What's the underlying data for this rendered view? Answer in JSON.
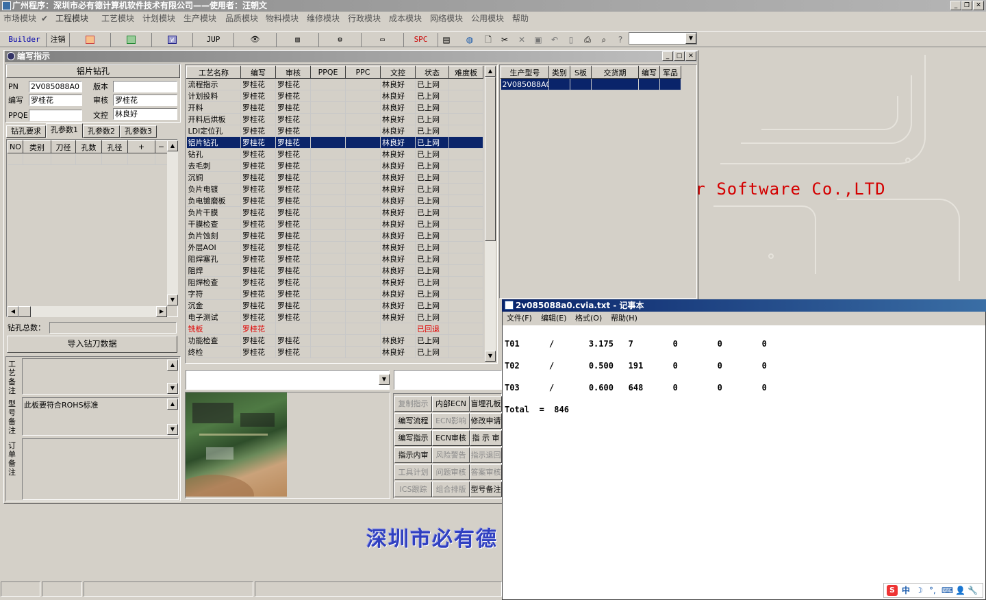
{
  "app": {
    "title": "广州程序：深圳市必有德计算机软件技术有限公司——使用者：汪朝文",
    "menu": [
      "市场模块",
      "工程模块",
      "工艺模块",
      "计划模块",
      "生产模块",
      "品质模块",
      "物料模块",
      "维修模块",
      "行政模块",
      "成本模块",
      "网络模块",
      "公用模块",
      "帮助"
    ]
  },
  "toolbar": {
    "builder": "Builder",
    "logout": "注销",
    "jup": "JUP",
    "spc": "SPC"
  },
  "background": {
    "brand_text": "er Software Co.,LTD",
    "company_text": "深圳市必有德"
  },
  "child_window": {
    "title": "编写指示",
    "section_title": "铝片钻孔",
    "pn_label": "PN",
    "pn_value": "2V085088A0",
    "version_label": "版本",
    "version_value": "",
    "author_label": "编写",
    "author_value": "罗桂花",
    "review_label": "审核",
    "review_value": "罗桂花",
    "ppqe_label": "PPQE",
    "ppqe_value": "",
    "doc_label": "文控",
    "doc_value": "林良好",
    "tabs": [
      "钻孔要求",
      "孔参数1",
      "孔参数2",
      "孔参数3"
    ],
    "hole_columns": [
      "NO",
      "类别",
      "刀径",
      "孔数",
      "孔径",
      "+",
      "−"
    ],
    "total_label": "钻孔总数：",
    "total_value": "",
    "import_button": "导入钻刀数据",
    "remark_labels": [
      "工艺备注",
      "型号备注",
      "订单备注"
    ],
    "model_remark": "此板要符合ROHS标准"
  },
  "process_table": {
    "columns": [
      "工艺名称",
      "编写",
      "审核",
      "PPQE",
      "PPC",
      "文控",
      "状态",
      "难度板"
    ],
    "rows": [
      [
        "流程指示",
        "罗桂花",
        "罗桂花",
        "",
        "",
        "林良好",
        "已上网",
        ""
      ],
      [
        "计划投料",
        "罗桂花",
        "罗桂花",
        "",
        "",
        "林良好",
        "已上网",
        ""
      ],
      [
        "开料",
        "罗桂花",
        "罗桂花",
        "",
        "",
        "林良好",
        "已上网",
        ""
      ],
      [
        "开料后烘板",
        "罗桂花",
        "罗桂花",
        "",
        "",
        "林良好",
        "已上网",
        ""
      ],
      [
        "LDI定位孔",
        "罗桂花",
        "罗桂花",
        "",
        "",
        "林良好",
        "已上网",
        ""
      ],
      [
        "铝片钻孔",
        "罗桂花",
        "罗桂花",
        "",
        "",
        "林良好",
        "已上网",
        ""
      ],
      [
        "钻孔",
        "罗桂花",
        "罗桂花",
        "",
        "",
        "林良好",
        "已上网",
        ""
      ],
      [
        "去毛刺",
        "罗桂花",
        "罗桂花",
        "",
        "",
        "林良好",
        "已上网",
        ""
      ],
      [
        "沉铜",
        "罗桂花",
        "罗桂花",
        "",
        "",
        "林良好",
        "已上网",
        ""
      ],
      [
        "负片电镀",
        "罗桂花",
        "罗桂花",
        "",
        "",
        "林良好",
        "已上网",
        ""
      ],
      [
        "负电镀磨板",
        "罗桂花",
        "罗桂花",
        "",
        "",
        "林良好",
        "已上网",
        ""
      ],
      [
        "负片干膜",
        "罗桂花",
        "罗桂花",
        "",
        "",
        "林良好",
        "已上网",
        ""
      ],
      [
        "干膜检查",
        "罗桂花",
        "罗桂花",
        "",
        "",
        "林良好",
        "已上网",
        ""
      ],
      [
        "负片蚀刻",
        "罗桂花",
        "罗桂花",
        "",
        "",
        "林良好",
        "已上网",
        ""
      ],
      [
        "外层AOI",
        "罗桂花",
        "罗桂花",
        "",
        "",
        "林良好",
        "已上网",
        ""
      ],
      [
        "阻焊塞孔",
        "罗桂花",
        "罗桂花",
        "",
        "",
        "林良好",
        "已上网",
        ""
      ],
      [
        "阻焊",
        "罗桂花",
        "罗桂花",
        "",
        "",
        "林良好",
        "已上网",
        ""
      ],
      [
        "阻焊检查",
        "罗桂花",
        "罗桂花",
        "",
        "",
        "林良好",
        "已上网",
        ""
      ],
      [
        "字符",
        "罗桂花",
        "罗桂花",
        "",
        "",
        "林良好",
        "已上网",
        ""
      ],
      [
        "沉金",
        "罗桂花",
        "罗桂花",
        "",
        "",
        "林良好",
        "已上网",
        ""
      ],
      [
        "电子测试",
        "罗桂花",
        "罗桂花",
        "",
        "",
        "林良好",
        "已上网",
        ""
      ],
      [
        "铣板",
        "罗桂花",
        "",
        "",
        "",
        "",
        "已回退",
        ""
      ],
      [
        "功能检查",
        "罗桂花",
        "罗桂花",
        "",
        "",
        "林良好",
        "已上网",
        ""
      ],
      [
        "终检",
        "罗桂花",
        "罗桂花",
        "",
        "",
        "林良好",
        "已上网",
        ""
      ]
    ],
    "selected_row": 5,
    "rejected_row": 21
  },
  "model_table": {
    "columns": [
      "生产型号",
      "类别",
      "S板",
      "交货期",
      "编写",
      "军品"
    ],
    "rows": [
      [
        "2V085088A0",
        "",
        "",
        "",
        "",
        ""
      ]
    ]
  },
  "action_buttons": [
    [
      "复制指示",
      "内部ECN",
      "盲埋孔板"
    ],
    [
      "编写流程",
      "ECN影响",
      "修改申请"
    ],
    [
      "编写指示",
      "ECN审核",
      "指 示 审"
    ],
    [
      "指示内审",
      "风险警告",
      "指示退回"
    ],
    [
      "工具计划",
      "问题审核",
      "答案审核"
    ],
    [
      "ICS跟踪",
      "组合排版",
      "型号备注"
    ]
  ],
  "disabled_buttons": [
    "复制指示",
    "ECN影响",
    "风险警告",
    "指示退回",
    "工具计划",
    "问题审核",
    "答案审核",
    "ICS跟踪",
    "组合排版"
  ],
  "notepad": {
    "title": "2v085088a0.cvia.txt - 记事本",
    "menu": [
      "文件(F)",
      "编辑(E)",
      "格式(O)",
      "帮助(H)"
    ],
    "lines": [
      "T01      /       3.175   7        0        0        0",
      "T02      /       0.500   191      0        0        0",
      "T03      /       0.600   648      0        0        0",
      "Total  =  846"
    ]
  },
  "ime": {
    "text": "中"
  }
}
